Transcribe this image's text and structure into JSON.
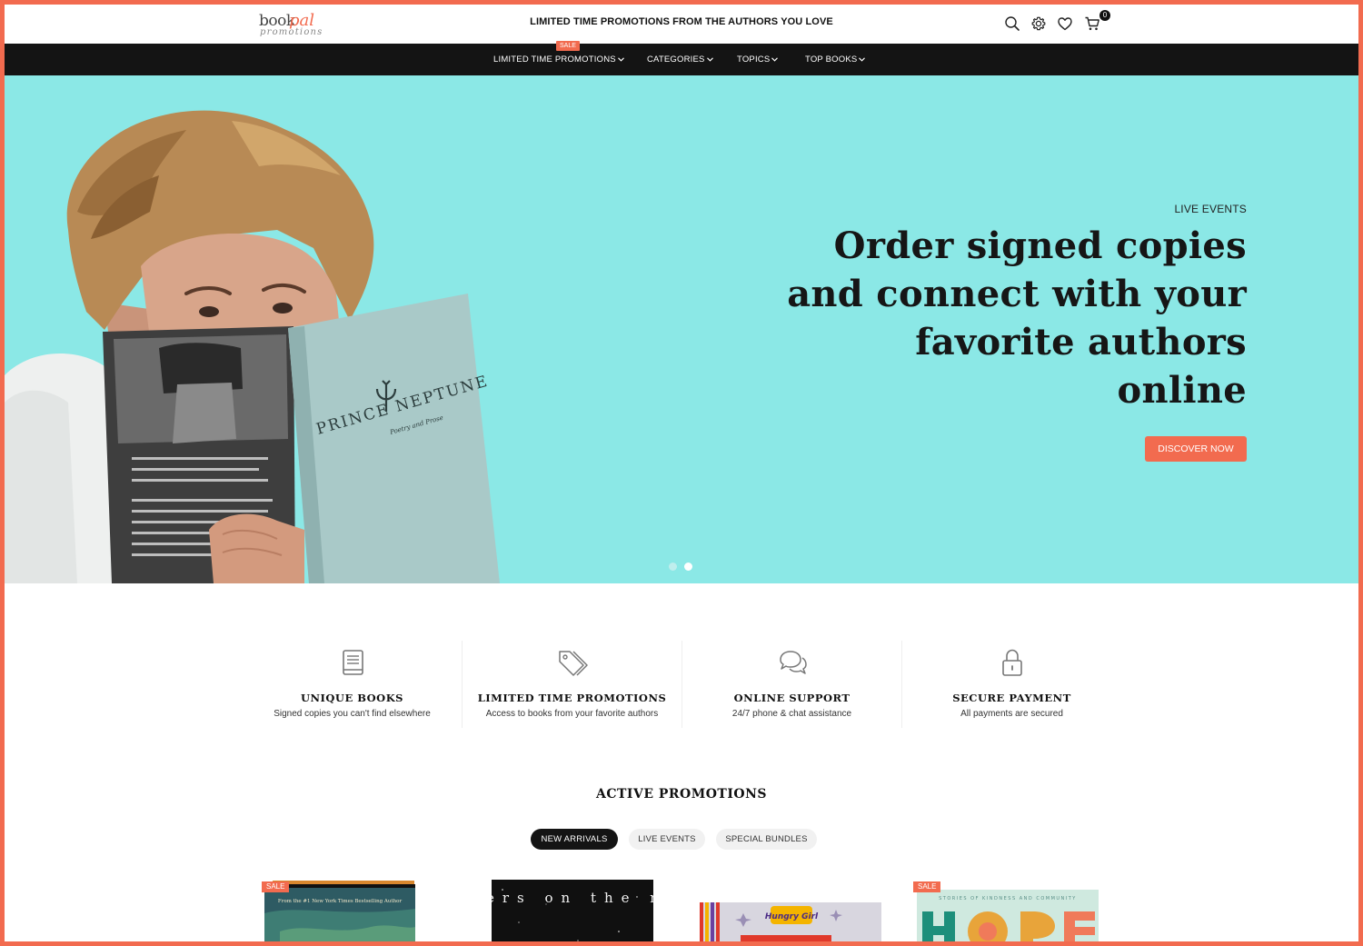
{
  "header": {
    "logo": {
      "primary": "book",
      "accent": "pal",
      "sub": "promotions"
    },
    "promo_text": "LIMITED TIME PROMOTIONS FROM THE AUTHORS YOU LOVE",
    "icons": [
      "search-icon",
      "gear-icon",
      "heart-icon",
      "cart-icon"
    ],
    "cart_count": "0"
  },
  "nav": {
    "items": [
      {
        "label": "LIMITED TIME PROMOTIONS",
        "badge": "SALE"
      },
      {
        "label": "CATEGORIES"
      },
      {
        "label": "TOPICS"
      },
      {
        "label": "TOP BOOKS"
      }
    ]
  },
  "hero": {
    "eyebrow": "LIVE EVENTS",
    "title": "Order signed copies and connect with your favorite authors online",
    "cta": "DISCOVER NOW",
    "book_cover_title": "PRINCE NEPTUNE",
    "book_cover_subtitle": "Poetry and Prose",
    "slides": 2,
    "active_slide": 2,
    "colors": {
      "background": "#8be8e6",
      "accent": "#f26b4f"
    }
  },
  "features": [
    {
      "icon": "book-icon",
      "title": "UNIQUE BOOKS",
      "subtitle": "Signed copies you can't find elsewhere"
    },
    {
      "icon": "tags-icon",
      "title": "LIMITED TIME PROMOTIONS",
      "subtitle": "Access to books from your favorite authors"
    },
    {
      "icon": "chat-icon",
      "title": "ONLINE SUPPORT",
      "subtitle": "24/7 phone & chat assistance"
    },
    {
      "icon": "lock-icon",
      "title": "SECURE PAYMENT",
      "subtitle": "All payments are secured"
    }
  ],
  "promotions": {
    "title": "ACTIVE PROMOTIONS",
    "tabs": [
      {
        "label": "NEW ARRIVALS",
        "active": true
      },
      {
        "label": "LIVE EVENTS",
        "active": false
      },
      {
        "label": "SPECIAL BUNDLES",
        "active": false
      }
    ],
    "products": [
      {
        "sale": "SALE",
        "cover_text": "From the #1 New York Times Bestselling Author"
      },
      {
        "sale": "",
        "cover_text": "flowers on the moon"
      },
      {
        "sale": "",
        "cover_text": "Hungry Girl"
      },
      {
        "sale": "SALE",
        "cover_text": "STORIES OF KINDNESS AND COMMUNITY"
      }
    ]
  }
}
